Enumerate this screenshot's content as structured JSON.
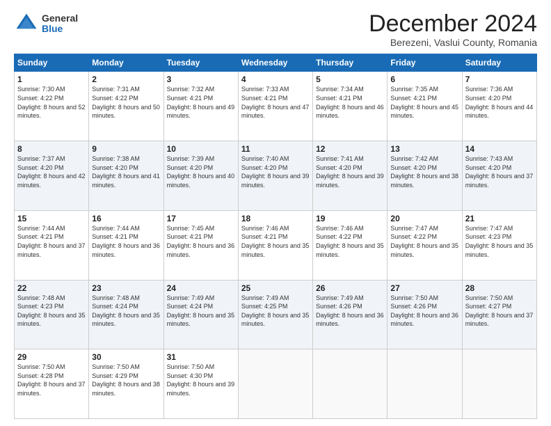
{
  "logo": {
    "general": "General",
    "blue": "Blue"
  },
  "title": "December 2024",
  "subtitle": "Berezeni, Vaslui County, Romania",
  "weekdays": [
    "Sunday",
    "Monday",
    "Tuesday",
    "Wednesday",
    "Thursday",
    "Friday",
    "Saturday"
  ],
  "weeks": [
    [
      {
        "day": "1",
        "sunrise": "7:30 AM",
        "sunset": "4:22 PM",
        "daylight": "8 hours and 52 minutes."
      },
      {
        "day": "2",
        "sunrise": "7:31 AM",
        "sunset": "4:22 PM",
        "daylight": "8 hours and 50 minutes."
      },
      {
        "day": "3",
        "sunrise": "7:32 AM",
        "sunset": "4:21 PM",
        "daylight": "8 hours and 49 minutes."
      },
      {
        "day": "4",
        "sunrise": "7:33 AM",
        "sunset": "4:21 PM",
        "daylight": "8 hours and 47 minutes."
      },
      {
        "day": "5",
        "sunrise": "7:34 AM",
        "sunset": "4:21 PM",
        "daylight": "8 hours and 46 minutes."
      },
      {
        "day": "6",
        "sunrise": "7:35 AM",
        "sunset": "4:21 PM",
        "daylight": "8 hours and 45 minutes."
      },
      {
        "day": "7",
        "sunrise": "7:36 AM",
        "sunset": "4:20 PM",
        "daylight": "8 hours and 44 minutes."
      }
    ],
    [
      {
        "day": "8",
        "sunrise": "7:37 AM",
        "sunset": "4:20 PM",
        "daylight": "8 hours and 42 minutes."
      },
      {
        "day": "9",
        "sunrise": "7:38 AM",
        "sunset": "4:20 PM",
        "daylight": "8 hours and 41 minutes."
      },
      {
        "day": "10",
        "sunrise": "7:39 AM",
        "sunset": "4:20 PM",
        "daylight": "8 hours and 40 minutes."
      },
      {
        "day": "11",
        "sunrise": "7:40 AM",
        "sunset": "4:20 PM",
        "daylight": "8 hours and 39 minutes."
      },
      {
        "day": "12",
        "sunrise": "7:41 AM",
        "sunset": "4:20 PM",
        "daylight": "8 hours and 39 minutes."
      },
      {
        "day": "13",
        "sunrise": "7:42 AM",
        "sunset": "4:20 PM",
        "daylight": "8 hours and 38 minutes."
      },
      {
        "day": "14",
        "sunrise": "7:43 AM",
        "sunset": "4:20 PM",
        "daylight": "8 hours and 37 minutes."
      }
    ],
    [
      {
        "day": "15",
        "sunrise": "7:44 AM",
        "sunset": "4:21 PM",
        "daylight": "8 hours and 37 minutes."
      },
      {
        "day": "16",
        "sunrise": "7:44 AM",
        "sunset": "4:21 PM",
        "daylight": "8 hours and 36 minutes."
      },
      {
        "day": "17",
        "sunrise": "7:45 AM",
        "sunset": "4:21 PM",
        "daylight": "8 hours and 36 minutes."
      },
      {
        "day": "18",
        "sunrise": "7:46 AM",
        "sunset": "4:21 PM",
        "daylight": "8 hours and 35 minutes."
      },
      {
        "day": "19",
        "sunrise": "7:46 AM",
        "sunset": "4:22 PM",
        "daylight": "8 hours and 35 minutes."
      },
      {
        "day": "20",
        "sunrise": "7:47 AM",
        "sunset": "4:22 PM",
        "daylight": "8 hours and 35 minutes."
      },
      {
        "day": "21",
        "sunrise": "7:47 AM",
        "sunset": "4:23 PM",
        "daylight": "8 hours and 35 minutes."
      }
    ],
    [
      {
        "day": "22",
        "sunrise": "7:48 AM",
        "sunset": "4:23 PM",
        "daylight": "8 hours and 35 minutes."
      },
      {
        "day": "23",
        "sunrise": "7:48 AM",
        "sunset": "4:24 PM",
        "daylight": "8 hours and 35 minutes."
      },
      {
        "day": "24",
        "sunrise": "7:49 AM",
        "sunset": "4:24 PM",
        "daylight": "8 hours and 35 minutes."
      },
      {
        "day": "25",
        "sunrise": "7:49 AM",
        "sunset": "4:25 PM",
        "daylight": "8 hours and 35 minutes."
      },
      {
        "day": "26",
        "sunrise": "7:49 AM",
        "sunset": "4:26 PM",
        "daylight": "8 hours and 36 minutes."
      },
      {
        "day": "27",
        "sunrise": "7:50 AM",
        "sunset": "4:26 PM",
        "daylight": "8 hours and 36 minutes."
      },
      {
        "day": "28",
        "sunrise": "7:50 AM",
        "sunset": "4:27 PM",
        "daylight": "8 hours and 37 minutes."
      }
    ],
    [
      {
        "day": "29",
        "sunrise": "7:50 AM",
        "sunset": "4:28 PM",
        "daylight": "8 hours and 37 minutes."
      },
      {
        "day": "30",
        "sunrise": "7:50 AM",
        "sunset": "4:29 PM",
        "daylight": "8 hours and 38 minutes."
      },
      {
        "day": "31",
        "sunrise": "7:50 AM",
        "sunset": "4:30 PM",
        "daylight": "8 hours and 39 minutes."
      },
      null,
      null,
      null,
      null
    ]
  ]
}
